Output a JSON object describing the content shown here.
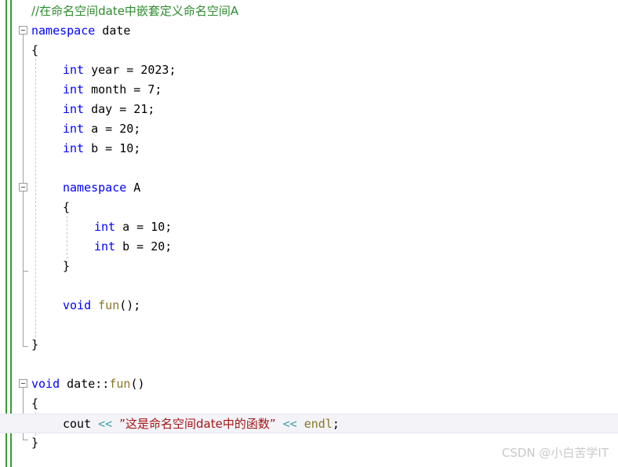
{
  "editor": {
    "language": "cpp",
    "colors": {
      "keyword": "#0000ff",
      "comment": "#2e8b2e",
      "string": "#a31515",
      "operator": "#3f9ea5",
      "function": "#8a7524",
      "plain": "#000000",
      "change_bar": "#3a9b35",
      "current_line_bg": "#f3f3f8",
      "fold_marker": "#9a9a9a",
      "indent_guide": "#c8c8c8",
      "watermark": "#c9c9c9"
    }
  },
  "code": {
    "lines": [
      {
        "indent": 0,
        "tokens": [
          {
            "t": "//在命名空间date中嵌套定义命名空间A",
            "c": "cmt"
          }
        ]
      },
      {
        "indent": 0,
        "tokens": [
          {
            "t": "namespace",
            "c": "kw"
          },
          {
            "t": " date",
            "c": "plain"
          }
        ]
      },
      {
        "indent": 0,
        "tokens": [
          {
            "t": "{",
            "c": "plain"
          }
        ]
      },
      {
        "indent": 1,
        "tokens": [
          {
            "t": "int",
            "c": "kw"
          },
          {
            "t": " year = 2023;",
            "c": "plain"
          }
        ]
      },
      {
        "indent": 1,
        "tokens": [
          {
            "t": "int",
            "c": "kw"
          },
          {
            "t": " month = 7;",
            "c": "plain"
          }
        ]
      },
      {
        "indent": 1,
        "tokens": [
          {
            "t": "int",
            "c": "kw"
          },
          {
            "t": " day = 21;",
            "c": "plain"
          }
        ]
      },
      {
        "indent": 1,
        "tokens": [
          {
            "t": "int",
            "c": "kw"
          },
          {
            "t": " a = 20;",
            "c": "plain"
          }
        ]
      },
      {
        "indent": 1,
        "tokens": [
          {
            "t": "int",
            "c": "kw"
          },
          {
            "t": " b = 10;",
            "c": "plain"
          }
        ]
      },
      {
        "indent": 0,
        "tokens": []
      },
      {
        "indent": 1,
        "tokens": [
          {
            "t": "namespace",
            "c": "kw"
          },
          {
            "t": " A",
            "c": "plain"
          }
        ]
      },
      {
        "indent": 1,
        "tokens": [
          {
            "t": "{",
            "c": "plain"
          }
        ]
      },
      {
        "indent": 2,
        "tokens": [
          {
            "t": "int",
            "c": "kw"
          },
          {
            "t": " a = 10;",
            "c": "plain"
          }
        ]
      },
      {
        "indent": 2,
        "tokens": [
          {
            "t": "int",
            "c": "kw"
          },
          {
            "t": " b = 20;",
            "c": "plain"
          }
        ]
      },
      {
        "indent": 1,
        "tokens": [
          {
            "t": "}",
            "c": "plain"
          }
        ]
      },
      {
        "indent": 0,
        "tokens": []
      },
      {
        "indent": 1,
        "tokens": [
          {
            "t": "void",
            "c": "kw"
          },
          {
            "t": " ",
            "c": "plain"
          },
          {
            "t": "fun",
            "c": "fn"
          },
          {
            "t": "();",
            "c": "plain"
          }
        ]
      },
      {
        "indent": 0,
        "tokens": []
      },
      {
        "indent": 0,
        "tokens": [
          {
            "t": "}",
            "c": "plain"
          }
        ]
      },
      {
        "indent": 0,
        "tokens": []
      },
      {
        "indent": 0,
        "tokens": [
          {
            "t": "void",
            "c": "kw"
          },
          {
            "t": " date::",
            "c": "plain"
          },
          {
            "t": "fun",
            "c": "fn"
          },
          {
            "t": "()",
            "c": "plain"
          }
        ]
      },
      {
        "indent": 0,
        "tokens": [
          {
            "t": "{",
            "c": "plain"
          }
        ]
      },
      {
        "indent": 1,
        "current": true,
        "tokens": [
          {
            "t": "cout ",
            "c": "plain"
          },
          {
            "t": "<<",
            "c": "op"
          },
          {
            "t": " ",
            "c": "plain"
          },
          {
            "t": "”这是命名空间date中的函数”",
            "c": "str"
          },
          {
            "t": " ",
            "c": "plain"
          },
          {
            "t": "<<",
            "c": "op"
          },
          {
            "t": " ",
            "c": "plain"
          },
          {
            "t": "endl",
            "c": "fn"
          },
          {
            "t": ";",
            "c": "plain"
          }
        ]
      },
      {
        "indent": 0,
        "tokens": [
          {
            "t": "}",
            "c": "plain"
          }
        ]
      }
    ]
  },
  "fold_markers": [
    {
      "name": "fold-namespace-date",
      "line": 1,
      "state": "expanded",
      "label": "-"
    },
    {
      "name": "fold-namespace-a",
      "line": 9,
      "state": "expanded",
      "label": "-"
    },
    {
      "name": "fold-function-date-fun",
      "line": 19,
      "state": "expanded",
      "label": "-"
    }
  ],
  "watermark": {
    "text": "CSDN @小白苦学IT"
  }
}
